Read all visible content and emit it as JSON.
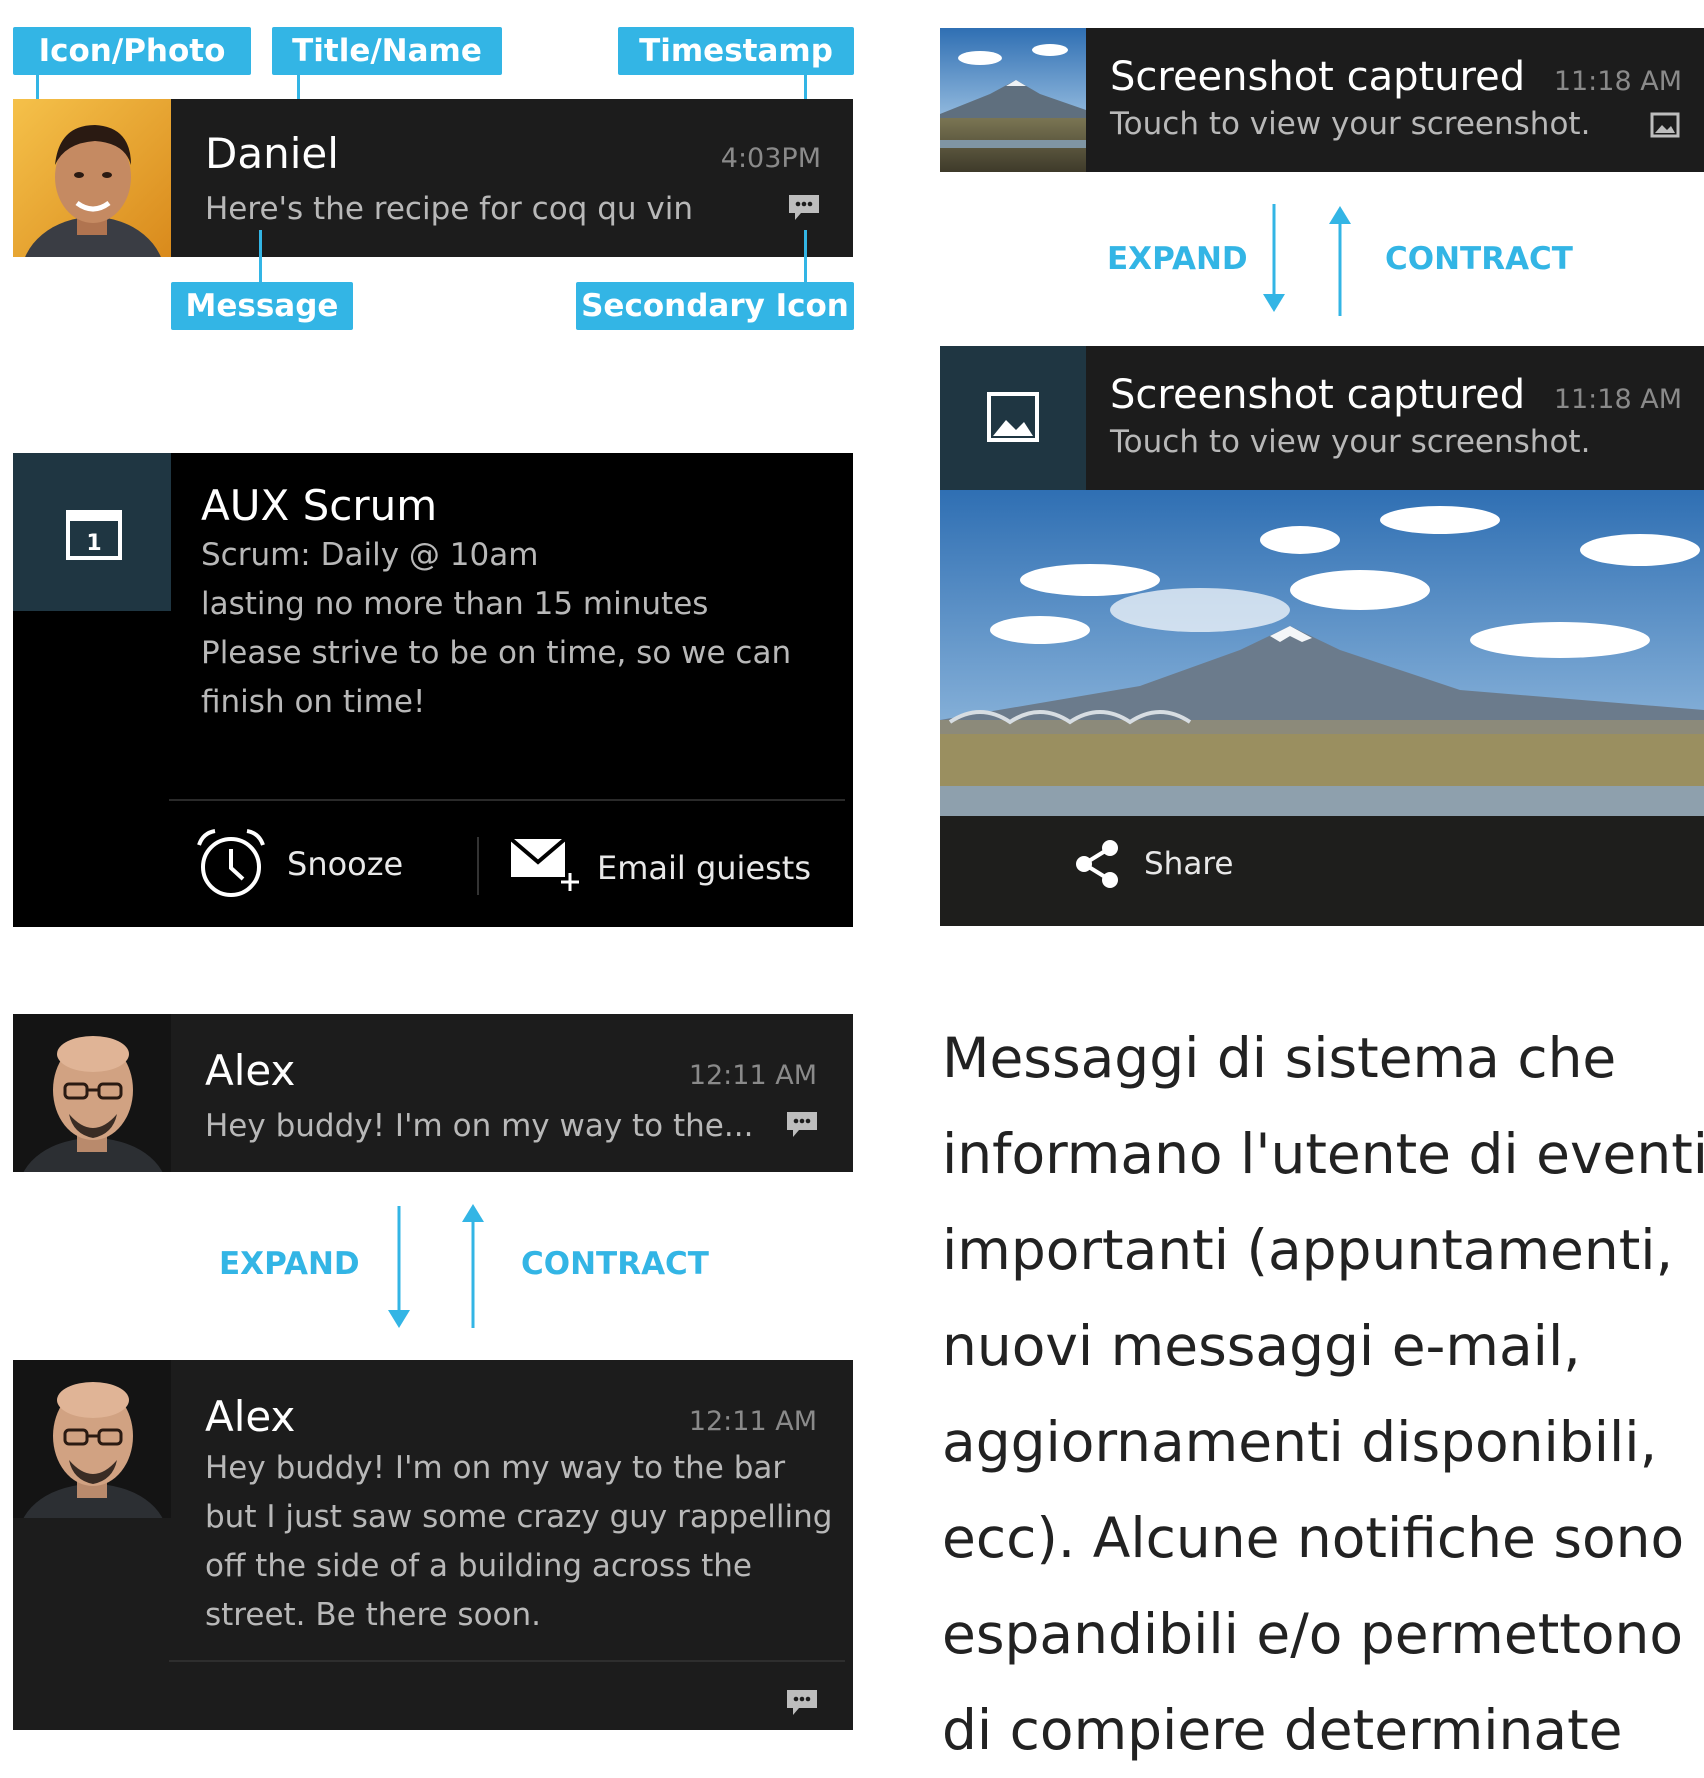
{
  "anatomy": {
    "labels": {
      "icon_photo": "Icon/Photo",
      "title_name": "Title/Name",
      "timestamp": "Timestamp",
      "message": "Message",
      "secondary_icon": "Secondary Icon"
    },
    "notification": {
      "title": "Daniel",
      "message": "Here's the recipe for coq qu vin",
      "time": "4:03PM",
      "avatar_icon": "person-photo",
      "secondary_icon": "chat-icon"
    }
  },
  "calendar": {
    "title": "AUX Scrum",
    "lines": [
      "Scrum: Daily @ 10am",
      "lasting no more than 15 minutes",
      "Please strive to be on time, so we can",
      "finish on time!"
    ],
    "icon_day": "1",
    "actions": [
      {
        "label": "Snooze",
        "icon": "alarm-clock-icon"
      },
      {
        "label": "Email guiests",
        "icon": "email-add-icon"
      }
    ]
  },
  "alex_collapsed": {
    "title": "Alex",
    "message": "Hey buddy! I'm on my way to the...",
    "time": "12:11 AM"
  },
  "alex_toggle": {
    "expand": "EXPAND",
    "contract": "CONTRACT"
  },
  "alex_expanded": {
    "title": "Alex",
    "time": "12:11 AM",
    "lines": [
      "Hey buddy! I'm on my way to the bar",
      "but I just saw some crazy guy rappelling",
      "off the side of a building across the",
      "street. Be there soon."
    ]
  },
  "screenshot_collapsed": {
    "title": "Screenshot captured",
    "message": "Touch to view your screenshot.",
    "time": "11:18 AM"
  },
  "screenshot_toggle": {
    "expand": "EXPAND",
    "contract": "CONTRACT"
  },
  "screenshot_expanded": {
    "title": "Screenshot captured",
    "message": "Touch to view your screenshot.",
    "time": "11:18 AM",
    "action": "Share",
    "image_subject": "mountain-landscape-photo"
  },
  "description_lines": [
    "Messaggi di sistema che",
    "informano l'utente di eventi",
    "importanti (appuntamenti,",
    "nuovi messaggi e-mail,",
    "aggiornamenti disponibili,",
    "ecc). Alcune notifiche sono",
    "espandibili e/o permettono",
    "di compiere determinate"
  ],
  "colors": {
    "accent": "#33b5e5",
    "notification_bg": "#1c1c1c",
    "icon_bg": "#1f3642"
  }
}
